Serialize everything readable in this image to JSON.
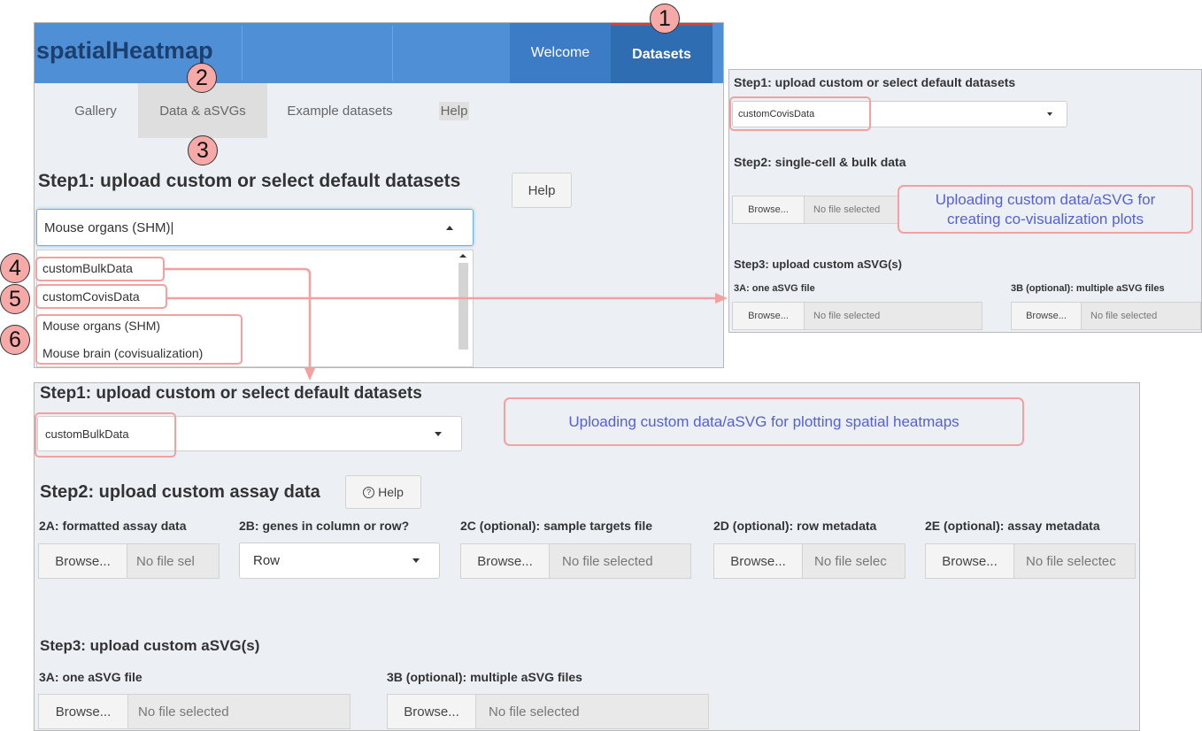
{
  "app": {
    "title": "spatialHeatmap",
    "nav": [
      "Welcome",
      "Datasets"
    ],
    "subnav": [
      "Gallery",
      "Data & aSVGs",
      "Example datasets",
      "Help"
    ],
    "colors": {
      "header_bg": "#4f8fd6",
      "active_tab": "#2f6db3",
      "annotation": "#f3a0a0",
      "note_text": "#5560d8"
    }
  },
  "main": {
    "step1": "Step1: upload custom or select default datasets",
    "help": "Help",
    "select_value": "Mouse organs (SHM)",
    "options": [
      "customBulkData",
      "customCovisData",
      "Mouse organs (SHM)",
      "Mouse brain (covisualization)"
    ]
  },
  "annotations": {
    "n1": "1",
    "n2": "2",
    "n3": "3",
    "n4": "4",
    "n5": "5",
    "n6": "6"
  },
  "covis": {
    "step1": "Step1: upload custom or select default datasets",
    "select_value": "customCovisData",
    "step2": "Step2: single-cell & bulk data",
    "browse": "Browse...",
    "no_file": "No file selected",
    "note": "Uploading custom data/aSVG for creating co-visualization plots",
    "step3": "Step3: upload custom aSVG(s)",
    "label_3a": "3A: one aSVG file",
    "label_3b": "3B (optional): multiple aSVG files"
  },
  "bulk": {
    "step1": "Step1: upload custom or select default datasets",
    "select_value": "customBulkData",
    "note": "Uploading custom data/aSVG for plotting spatial heatmaps",
    "step2": "Step2: upload custom assay data",
    "help": "Help",
    "label_2a": "2A: formatted assay data",
    "label_2b": "2B: genes in column or row?",
    "label_2c": "2C (optional): sample targets file",
    "label_2d": "2D (optional): row metadata",
    "label_2e": "2E (optional): assay metadata",
    "browse": "Browse...",
    "no_file_2a": "No file sel",
    "row_value": "Row",
    "no_file_2c": "No file selected",
    "no_file_2d": "No file selec",
    "no_file_2e": "No file selectec",
    "step3": "Step3: upload custom aSVG(s)",
    "label_3a": "3A: one aSVG file",
    "label_3b": "3B (optional): multiple aSVG files",
    "no_file_3a": "No file selected",
    "no_file_3b": "No file selected"
  }
}
